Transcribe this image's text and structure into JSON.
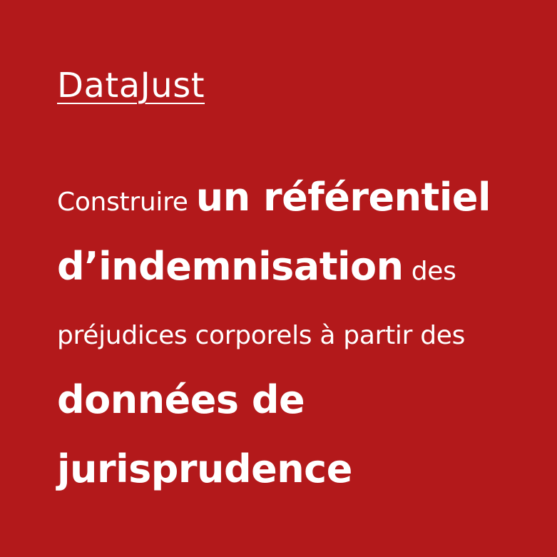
{
  "brand": {
    "title": "DataJust"
  },
  "headline": {
    "line1_normal": "Construire ",
    "line1_strong": "un référentiel",
    "line2_strong": "d’indemnisation",
    "line2_normal": " des",
    "line3_normal": "préjudices corporels à partir des",
    "line4_strong": "données de",
    "line5_strong": "jurisprudence"
  },
  "colors": {
    "background": "#b3191b",
    "text": "#ffffff"
  }
}
